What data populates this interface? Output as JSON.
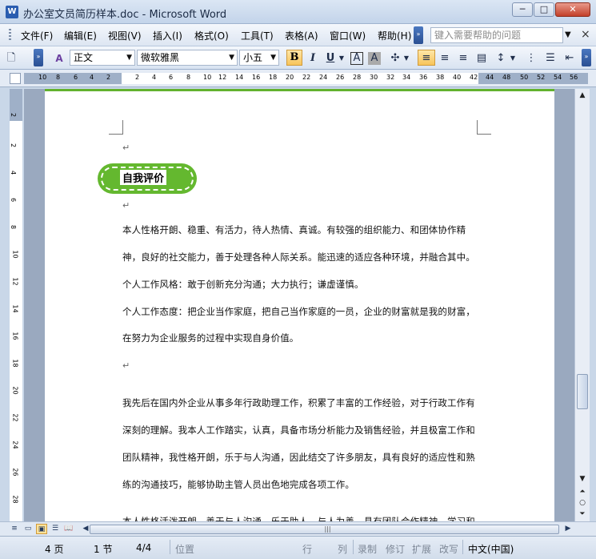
{
  "window": {
    "title": "办公室文员简历样本.doc - Microsoft Word",
    "app_icon": "W",
    "minimize": "─",
    "maximize": "□",
    "close": "✕"
  },
  "menu": {
    "items": [
      "文件(F)",
      "编辑(E)",
      "视图(V)",
      "插入(I)",
      "格式(O)",
      "工具(T)",
      "表格(A)",
      "窗口(W)",
      "帮助(H)"
    ],
    "help_placeholder": "键入需要帮助的问题",
    "close_doc": "×"
  },
  "toolbar": {
    "style": "正文",
    "font": "微软雅黑",
    "size": "小五",
    "bold": "B",
    "italic": "I",
    "underline": "U",
    "char_border": "A",
    "char_shading": "A",
    "highlight": "A"
  },
  "ruler": {
    "numbers": [
      "10",
      "8",
      "6",
      "4",
      "2",
      "2",
      "4",
      "6",
      "8",
      "10",
      "12",
      "14",
      "16",
      "18",
      "20",
      "22",
      "24",
      "26",
      "28",
      "30",
      "32",
      "34",
      "36",
      "38",
      "40",
      "42",
      "44",
      "48",
      "50",
      "52",
      "54",
      "56"
    ]
  },
  "vruler": {
    "numbers": [
      "2",
      "2",
      "4",
      "6",
      "8",
      "10",
      "12",
      "14",
      "16",
      "18",
      "20",
      "22",
      "24",
      "26",
      "28"
    ]
  },
  "document": {
    "para_marks": [
      "↵",
      "↵",
      "↵",
      "↵"
    ],
    "section_title": "自我评价",
    "lines": [
      " 本人性格开朗、稳重、有活力，待人热情、真诚。有较强的组织能力、和团体协作精",
      "神，良好的社交能力，善于处理各种人际关系。能迅速的适应各种环境，并融合其中。",
      "个人工作风格：敢于创新充分沟通；大力执行；谦虚谨慎。",
      "个人工作态度：把企业当作家庭，把自己当作家庭的一员，企业的财富就是我的财富，",
      "在努力为企业服务的过程中实现自身价值。",
      "我先后在国内外企业从事多年行政助理工作，积累了丰富的工作经验，对于行政工作有",
      "深刻的理解。我本人工作踏实，认真，具备市场分析能力及销售经验，并且极富工作和",
      "团队精神，我性格开朗，乐于与人沟通，因此结交了许多朋友，具有良好的适应性和熟",
      "练的沟通技巧，能够协助主管人员出色地完成各项工作。",
      "本人性格活泼开朗，善于与人沟通，乐于助人，与人为善，具有团队合作精神，学习和"
    ]
  },
  "status": {
    "page": "4 页",
    "section": "1 节",
    "page_of": "4/4",
    "position": "位置",
    "line": "行",
    "col": "列",
    "rec": "录制",
    "trk": "修订",
    "ext": "扩展",
    "ovr": "改写",
    "lang": "中文(中国)"
  },
  "colors": {
    "accent_green": "#64b82f",
    "bold_active": "#f7c45a"
  }
}
